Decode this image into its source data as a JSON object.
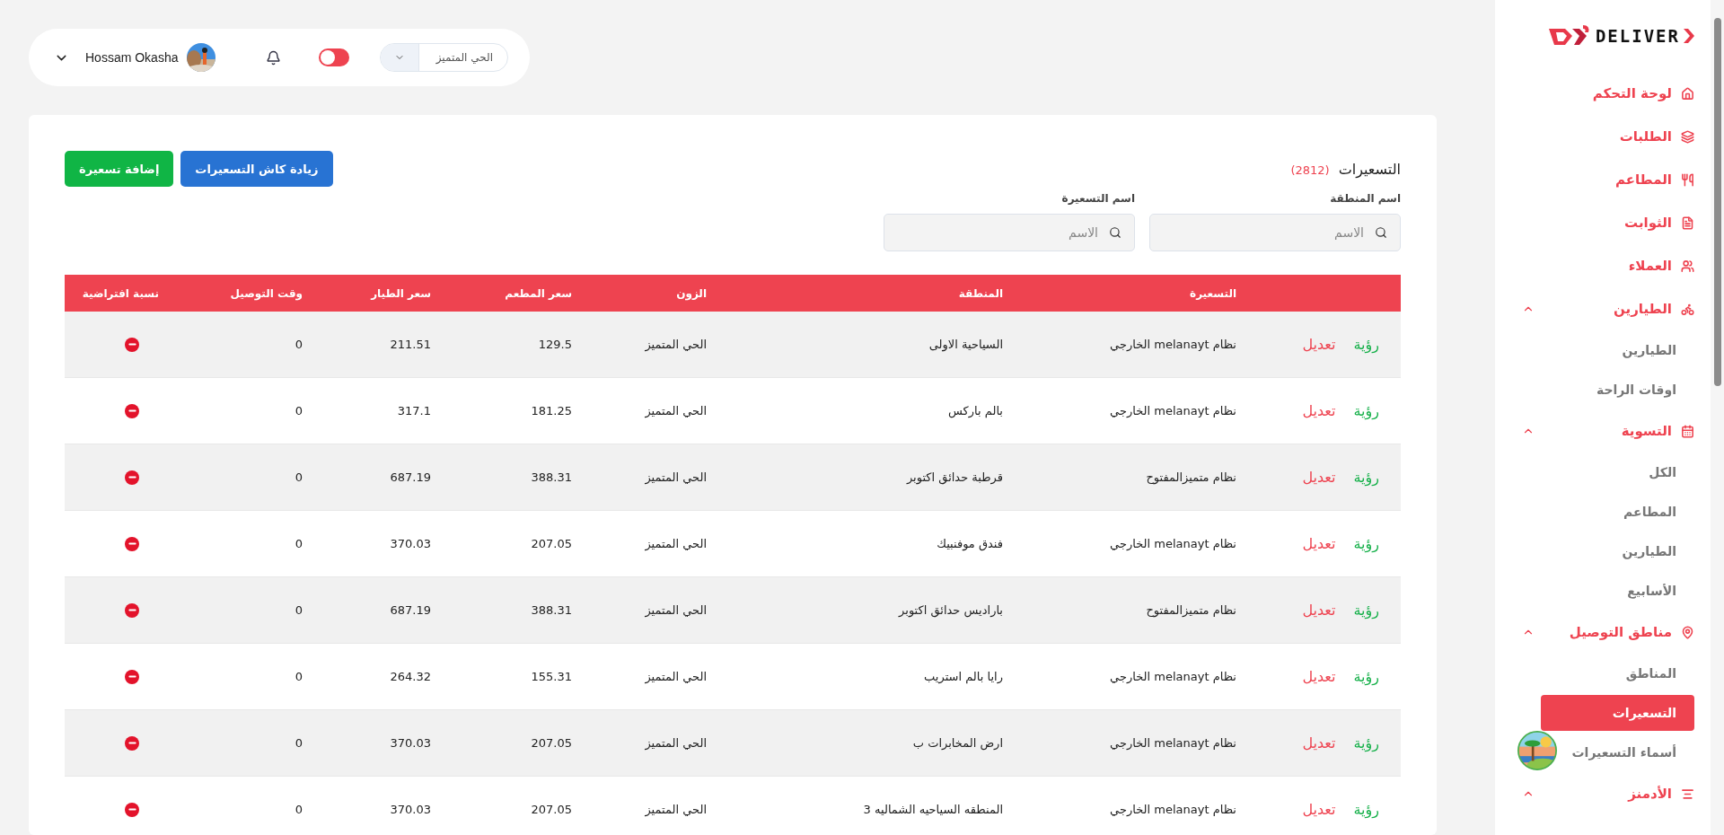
{
  "top_bar": {
    "zone_select": {
      "value": "الحي المتميز"
    },
    "toggle": {
      "on": false
    },
    "user": {
      "name": "Hossam Okasha"
    }
  },
  "sidebar": {
    "logo_text": "DELIVER",
    "items": [
      {
        "label": "لوحة التحكم",
        "selected": false
      },
      {
        "label": "الطلبات",
        "selected": false
      },
      {
        "label": "المطاعم",
        "selected": false
      },
      {
        "label": "الثوابت",
        "selected": false
      },
      {
        "label": "العملاء",
        "selected": false
      },
      {
        "label": "الطيارين",
        "selected": false,
        "expanded": true,
        "children": [
          {
            "label": "الطيارين",
            "selected": false
          },
          {
            "label": "اوقات الراحة",
            "selected": false
          }
        ]
      },
      {
        "label": "التسوية",
        "selected": false,
        "expanded": true,
        "children": [
          {
            "label": "الكل",
            "selected": false
          },
          {
            "label": "المطاعم",
            "selected": false
          },
          {
            "label": "الطيارين",
            "selected": false
          },
          {
            "label": "الأسابيع",
            "selected": false
          }
        ]
      },
      {
        "label": "مناطق التوصيل",
        "selected": false,
        "expanded": true,
        "children": [
          {
            "label": "المناطق",
            "selected": false
          },
          {
            "label": "التسعيرات",
            "selected": true
          },
          {
            "label": "أسماء التسعيرات",
            "selected": false
          }
        ]
      },
      {
        "label": "الأدمنز",
        "selected": false,
        "expanded": true
      }
    ]
  },
  "page": {
    "title": "التسعيرات",
    "count": "(2812)",
    "buttons": [
      {
        "label": "زيادة كاش التسعيرات",
        "kind": "primary"
      },
      {
        "label": "إضافة تسعيرة",
        "kind": "success"
      }
    ],
    "filters": [
      {
        "label": "اسم المنطقة",
        "placeholder": "الاسم"
      },
      {
        "label": "اسم التسعيرة",
        "placeholder": "الاسم"
      }
    ],
    "table": {
      "columns": [
        "التسعيرة",
        "المنطقة",
        "الزون",
        "سعر المطعم",
        "سعر الطيار",
        "وقت التوصيل",
        "نسبة افتراضية"
      ],
      "rows": [
        {
          "view": "رؤية",
          "edit": "تعديل",
          "pricing": "نظام melanayt الخارجي",
          "region": "السياحية الاولى",
          "zone": "الحي المتميز",
          "restaurant_price": "129.5",
          "rider_price": "211.51",
          "delivery_time": "0",
          "default": false
        },
        {
          "view": "رؤية",
          "edit": "تعديل",
          "pricing": "نظام melanayt الخارجي",
          "region": "بالم باركس",
          "zone": "الحي المتميز",
          "restaurant_price": "181.25",
          "rider_price": "317.1",
          "delivery_time": "0",
          "default": false
        },
        {
          "view": "رؤية",
          "edit": "تعديل",
          "pricing": "نظام متميزالمفتوح",
          "region": "قرطبة حدائق اكتوبر",
          "zone": "الحي المتميز",
          "restaurant_price": "388.31",
          "rider_price": "687.19",
          "delivery_time": "0",
          "default": false
        },
        {
          "view": "رؤية",
          "edit": "تعديل",
          "pricing": "نظام melanayt الخارجي",
          "region": "فندق موفنبيك",
          "zone": "الحي المتميز",
          "restaurant_price": "207.05",
          "rider_price": "370.03",
          "delivery_time": "0",
          "default": false
        },
        {
          "view": "رؤية",
          "edit": "تعديل",
          "pricing": "نظام متميزالمفتوح",
          "region": "باراديس حدائق اكتوبر",
          "zone": "الحي المتميز",
          "restaurant_price": "388.31",
          "rider_price": "687.19",
          "delivery_time": "0",
          "default": false
        },
        {
          "view": "رؤية",
          "edit": "تعديل",
          "pricing": "نظام melanayt الخارجي",
          "region": "رايا بالم استريب",
          "zone": "الحي المتميز",
          "restaurant_price": "155.31",
          "rider_price": "264.32",
          "delivery_time": "0",
          "default": false
        },
        {
          "view": "رؤية",
          "edit": "تعديل",
          "pricing": "نظام melanayt الخارجي",
          "region": "ارض المخابرات ب",
          "zone": "الحي المتميز",
          "restaurant_price": "207.05",
          "rider_price": "370.03",
          "delivery_time": "0",
          "default": false
        },
        {
          "view": "رؤية",
          "edit": "تعديل",
          "pricing": "نظام melanayt الخارجي",
          "region": "المنطقه السياحيه الشماليه 3",
          "zone": "الحي المتميز",
          "restaurant_price": "207.05",
          "rider_price": "370.03",
          "delivery_time": "0",
          "default": false
        }
      ]
    }
  }
}
